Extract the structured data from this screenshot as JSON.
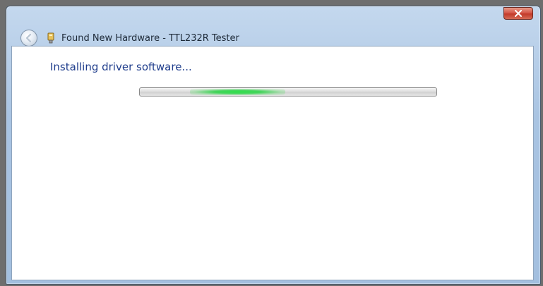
{
  "window": {
    "title": "Found New Hardware - TTL232R Tester"
  },
  "content": {
    "status_heading": "Installing driver software..."
  },
  "progress": {
    "style": "marquee",
    "indicator_center_fraction": 0.33,
    "indicator_width_fraction": 0.32,
    "color": "#2ee04a"
  },
  "icons": {
    "back": "back-arrow-icon",
    "title": "hardware-device-icon",
    "close": "close-icon"
  },
  "colors": {
    "title_bar": "#a9c4e2",
    "heading_text": "#1f3d8c",
    "close_button": "#c23b2a"
  }
}
